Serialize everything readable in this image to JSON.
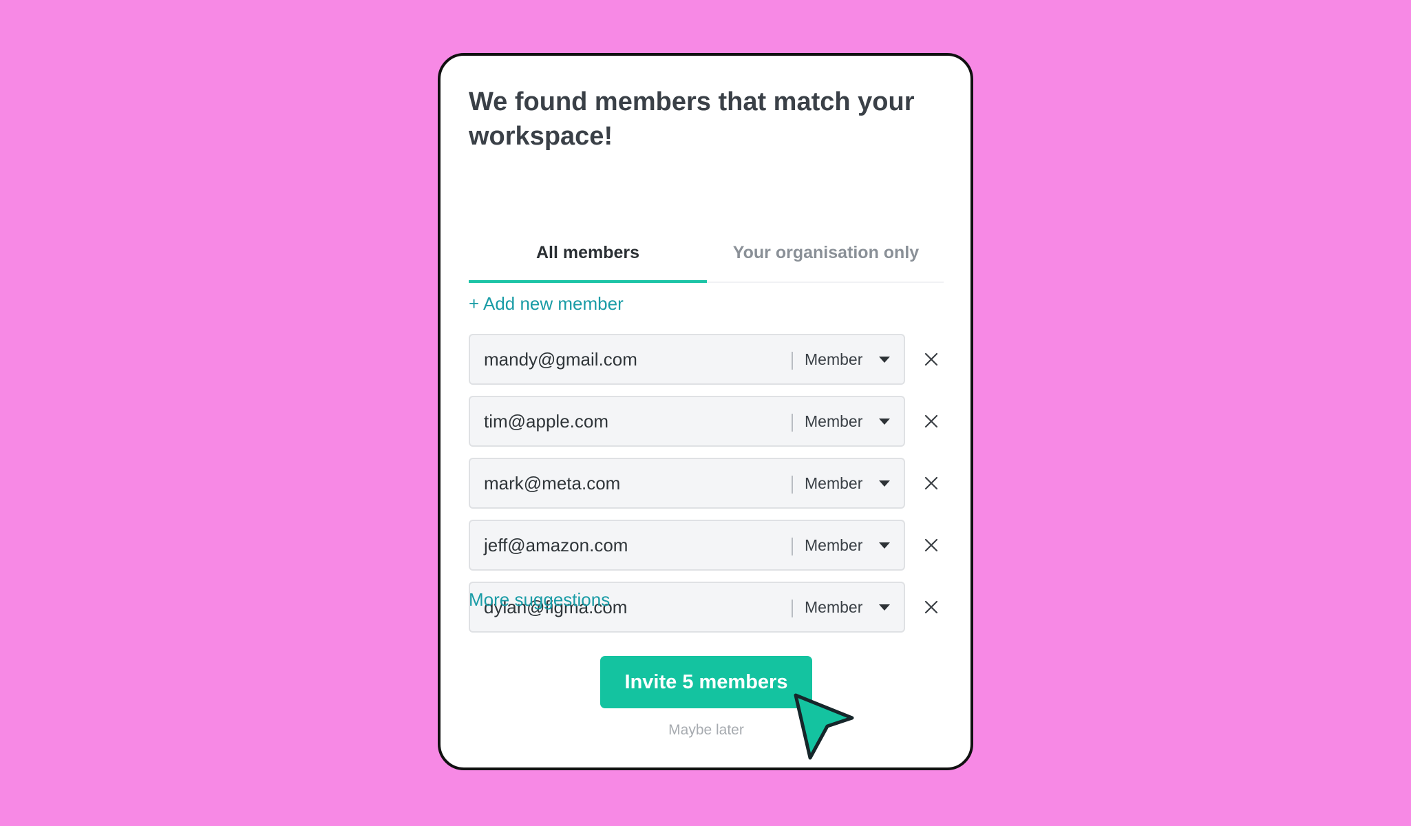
{
  "dialog": {
    "title": "We found members that match your workspace!"
  },
  "tabs": [
    {
      "label": "All members",
      "active": true
    },
    {
      "label": "Your organisation only",
      "active": false
    }
  ],
  "add_member_label": "+ Add new member",
  "members": [
    {
      "email": "mandy@gmail.com",
      "role": "Member"
    },
    {
      "email": "tim@apple.com",
      "role": "Member"
    },
    {
      "email": "mark@meta.com",
      "role": "Member"
    },
    {
      "email": "jeff@amazon.com",
      "role": "Member"
    },
    {
      "email": "dylan@figma.com",
      "role": "Member"
    }
  ],
  "more_suggestions_label": "More suggestions",
  "invite_button_label": "Invite 5 members",
  "maybe_later_label": "Maybe later",
  "icons": {
    "remove": "close-icon",
    "role_dropdown": "caret-down-icon",
    "pointer": "mouse-pointer-icon"
  },
  "colors": {
    "background": "#f789e5",
    "accent": "#14c3a0",
    "link": "#1a9ca6",
    "title": "#3a4047"
  }
}
